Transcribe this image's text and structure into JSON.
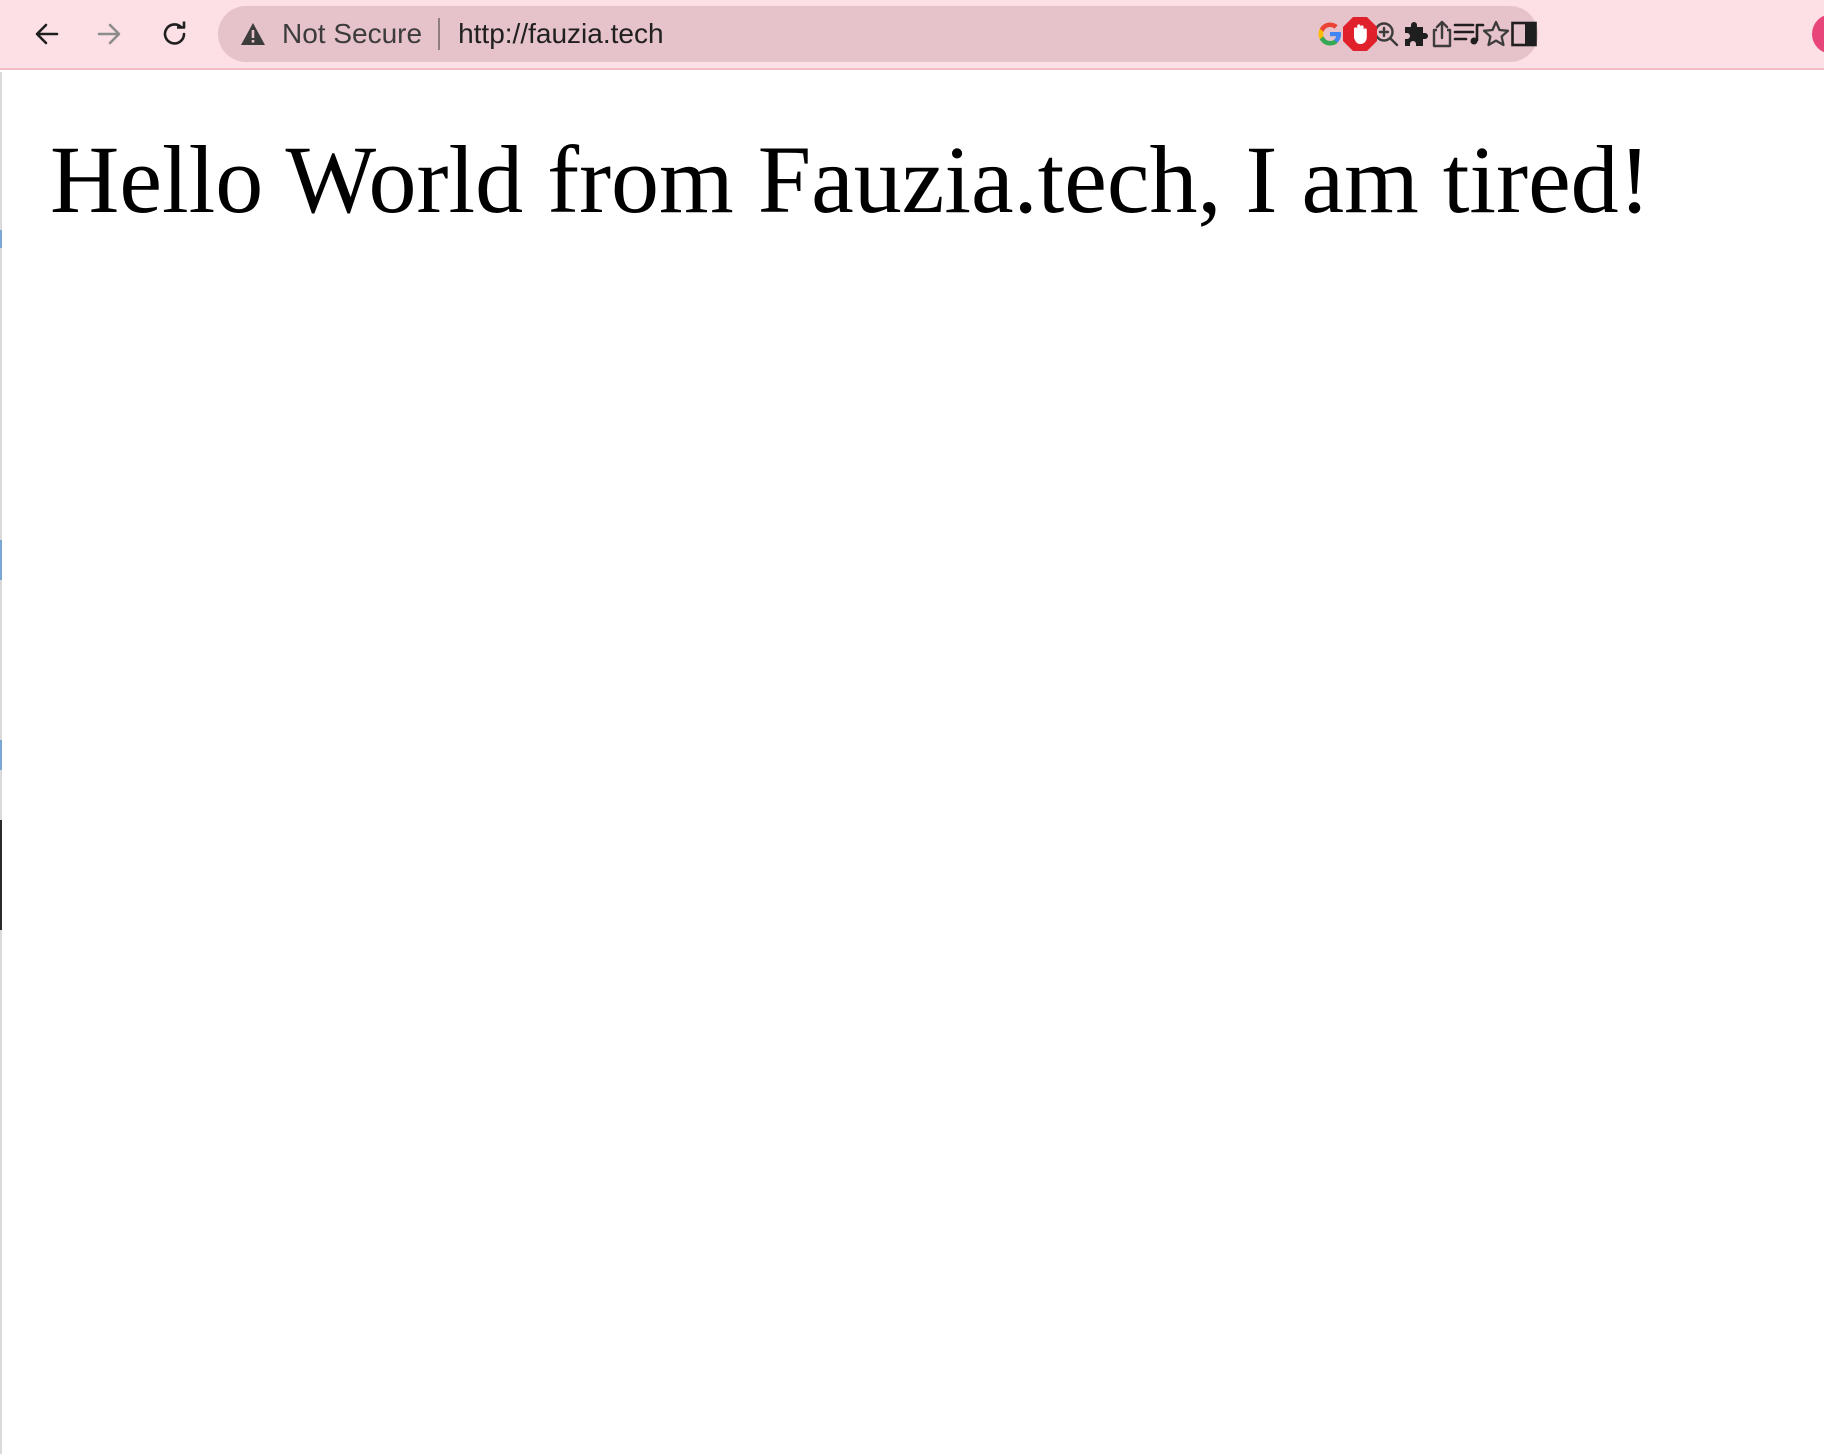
{
  "browser": {
    "toolbar_color": "#fde0e5",
    "omnibox_color": "#e6c2ca",
    "nav": {
      "back_icon": "arrow-left-icon",
      "forward_icon": "arrow-right-icon",
      "reload_icon": "reload-icon"
    },
    "omnibox": {
      "security_icon": "warning-triangle-icon",
      "security_label": "Not Secure",
      "url": "http://fauzia.tech",
      "right_icons": [
        "google-icon",
        "zoom-in-icon",
        "share-icon",
        "star-icon"
      ]
    },
    "extensions": [
      "adblock-icon",
      "puzzle-extensions-icon",
      "media-queue-icon",
      "side-panel-icon"
    ],
    "profile_color": "#e8457a"
  },
  "page": {
    "heading": "Hello World from Fauzia.tech, I am tired!"
  }
}
